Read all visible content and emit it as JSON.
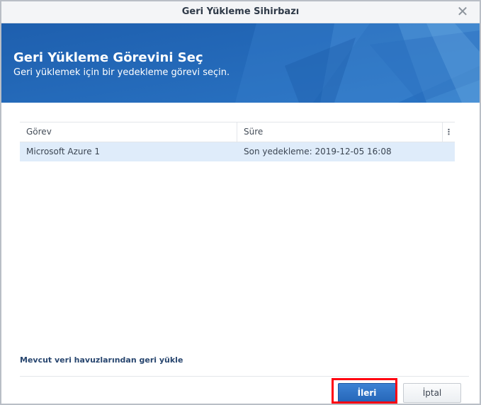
{
  "window": {
    "title": "Geri Yükleme Sihirbazı",
    "close_glyph": "✕"
  },
  "banner": {
    "title": "Geri Yükleme Görevini Seç",
    "subtitle": "Geri yüklemek için bir yedekleme görevi seçin.",
    "color": "#1f66b6"
  },
  "table": {
    "columns": [
      "Görev",
      "Süre"
    ],
    "column_menu_glyph": "⋮",
    "rows": [
      {
        "task": "Microsoft Azure 1",
        "time": "Son yedekleme: 2019-12-05 16:08",
        "selected": true
      }
    ]
  },
  "footer": {
    "pool_link": "Mevcut veri havuzlarından geri yükle",
    "next_label": "İleri",
    "cancel_label": "İptal",
    "highlight_color": "#ff0010"
  }
}
